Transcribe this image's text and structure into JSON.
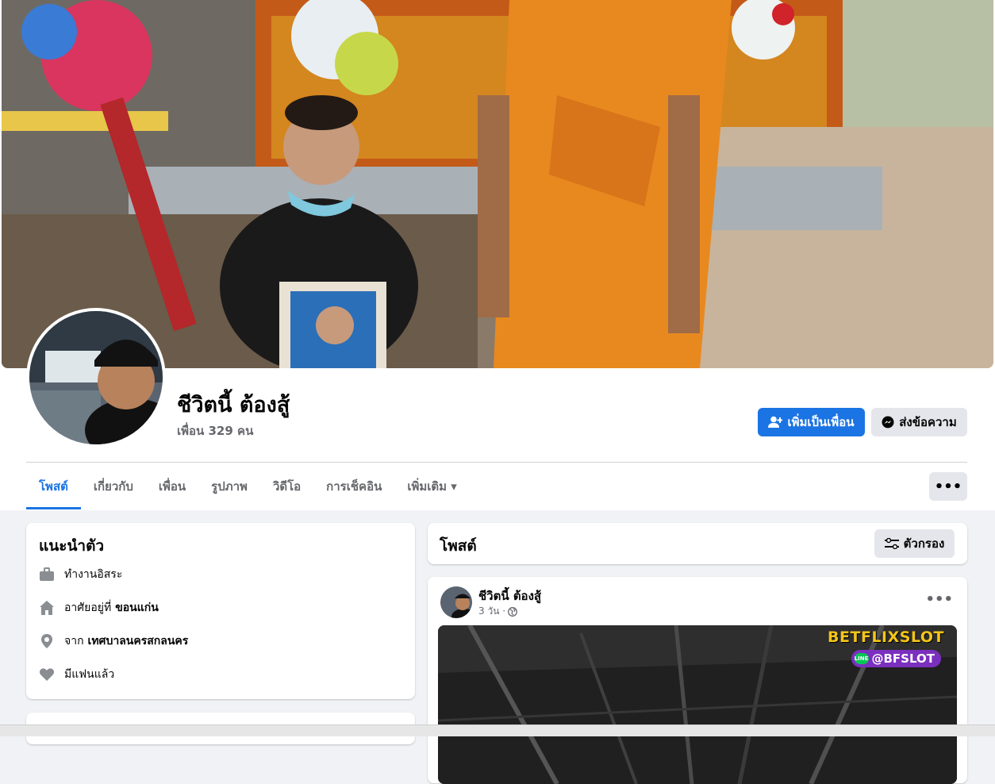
{
  "profile": {
    "name": "ชีวิตนี้ ต้องสู้",
    "friends_text": "เพื่อน 329 คน"
  },
  "actions": {
    "add_friend": "เพิ่มเป็นเพื่อน",
    "message": "ส่งข้อความ"
  },
  "tabs": [
    {
      "label": "โพสต์",
      "active": true
    },
    {
      "label": "เกี่ยวกับ"
    },
    {
      "label": "เพื่อน"
    },
    {
      "label": "รูปภาพ"
    },
    {
      "label": "วิดีโอ"
    },
    {
      "label": "การเช็คอิน"
    },
    {
      "label": "เพิ่มเติม ▾"
    }
  ],
  "more_button": "•••",
  "intro": {
    "title": "แนะนำตัว",
    "work": "ทำงานอิสระ",
    "lives_prefix": "อาศัยอยู่ที่",
    "lives_place": "ขอนแก่น",
    "from_prefix": "จาก",
    "from_place": "เทศบาลนครสกลนคร",
    "relationship": "มีแฟนแล้ว"
  },
  "posts_section": {
    "title": "โพสต์",
    "filter": "ตัวกรอง"
  },
  "post": {
    "author": "ชีวิตนี้ ต้องสู้",
    "time": "3 วัน ·",
    "more": "•••",
    "image_brand": "BETFLIXSLOT",
    "image_line_id": "@BFSLOT",
    "line_badge": "LINE"
  },
  "colors": {
    "accent": "#1b74e4",
    "background": "#f0f2f5",
    "robe": "#e8891f"
  }
}
